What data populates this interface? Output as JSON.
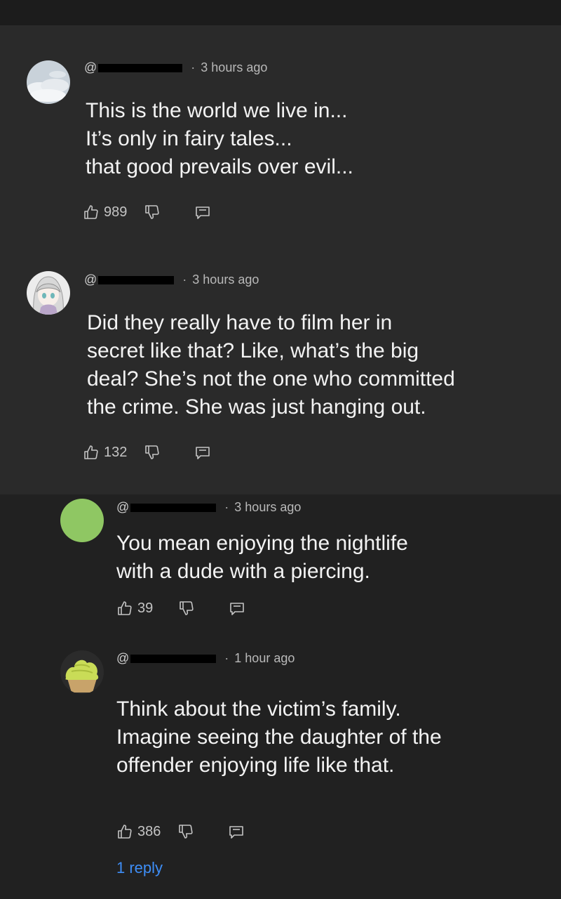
{
  "comments": [
    {
      "handle_prefix": "@",
      "time": "3 hours ago",
      "lines": [
        "This is the world we live in...",
        "It’s only in fairy tales...",
        "that good prevails over evil..."
      ],
      "likes": "989",
      "avatar": "clouds-photo"
    },
    {
      "handle_prefix": "@",
      "time": "3 hours ago",
      "lines": [
        "Did they really have to film her in",
        "secret like that? Like, what’s the big",
        "deal? She’s not the one who committed",
        "the crime. She was just hanging out."
      ],
      "likes": "132",
      "avatar": "anime-girl-drawing"
    },
    {
      "handle_prefix": "@",
      "time": "3 hours ago",
      "lines": [
        "You mean enjoying the nightlife",
        "with a dude with a piercing."
      ],
      "likes": "39",
      "avatar": "green-circle"
    },
    {
      "handle_prefix": "@",
      "time": "1 hour ago",
      "lines": [
        "Think about the victim’s family.",
        "Imagine seeing the daughter of the",
        "offender enjoying life like that."
      ],
      "likes": "386",
      "avatar": "green-cupcake",
      "replies_label": "1 reply"
    }
  ],
  "colors": {
    "background": "#212121",
    "highlight_panel": "#2a2a2a",
    "link": "#3e8ef7",
    "avatar_green": "#8fc763"
  }
}
